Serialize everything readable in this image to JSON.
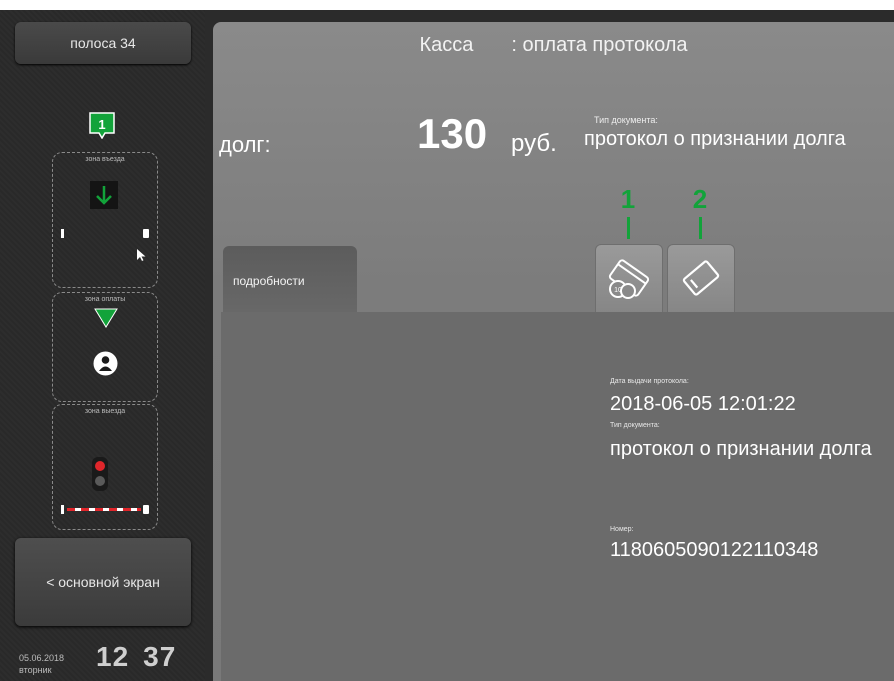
{
  "sidebar": {
    "lane": "полоса 34",
    "flag_number": "1",
    "zones": [
      "зона въезда",
      "зона оплаты",
      "зона выезда"
    ],
    "main_screen": "< основной экран",
    "date": "05.06.2018",
    "weekday": "вторник",
    "hours": "12",
    "minutes": "37"
  },
  "header": {
    "title_left": "Касса",
    "title_right": ": оплата протокола"
  },
  "debt": {
    "label": "долг:",
    "amount": "130",
    "currency": "руб."
  },
  "document": {
    "type_label": "Тип документа:",
    "type_value": "протокол о признании долга"
  },
  "markers": [
    "1",
    "2"
  ],
  "tab": {
    "label": "подробности"
  },
  "details": {
    "issue_date_label": "Дата выдачи протокола:",
    "issue_date": "2018-06-05 12:01:22",
    "type_label": "Тип документа:",
    "type_value": "протокол о признании долга",
    "number_label": "Номер:",
    "number": "1180605090122110348"
  },
  "colors": {
    "accent_green": "#12a33a",
    "signal_red": "#e0262b",
    "panel_gray": "#7c7c7c"
  },
  "icons": [
    "card-icon",
    "ticket-icon",
    "arrow-down-icon",
    "triangle-down-icon",
    "person-icon",
    "traffic-light-icon",
    "cursor-icon"
  ]
}
